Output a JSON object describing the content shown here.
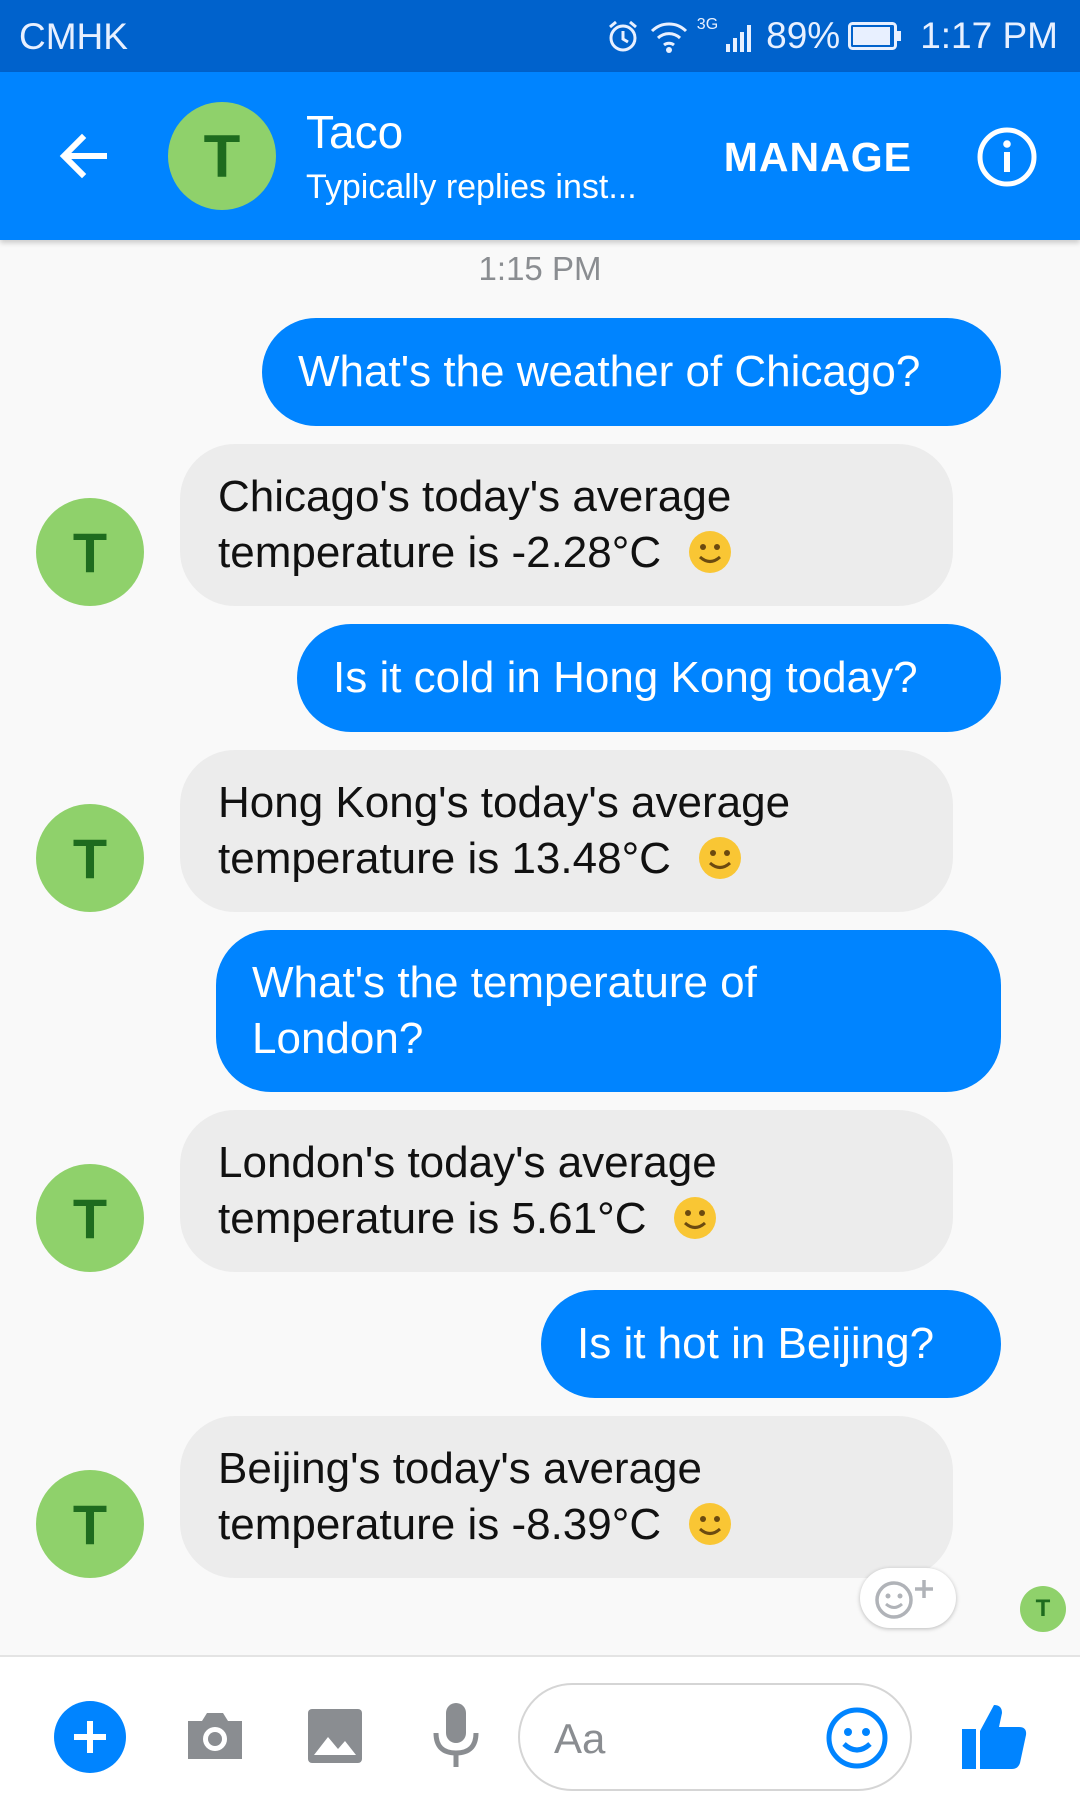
{
  "status_bar": {
    "carrier": "CMHK",
    "network": "3G",
    "battery": "89%",
    "time": "1:17 PM",
    "icons": [
      "alarm-icon",
      "wifi-icon",
      "signal-icon",
      "battery-icon"
    ]
  },
  "header": {
    "contact_initial": "T",
    "contact_name": "Taco",
    "contact_status": "Typically replies inst...",
    "manage_label": "MANAGE",
    "icons": [
      "back-arrow-icon",
      "info-icon"
    ]
  },
  "conversation": {
    "timestamp": "1:15 PM",
    "bot_initial": "T",
    "messages": [
      {
        "from": "user",
        "lines": [
          "What's the weather of Chicago?"
        ]
      },
      {
        "from": "bot",
        "lines": [
          "Chicago's today's average",
          "temperature is -2.28°C"
        ],
        "emoji": "slightly-smiling-face"
      },
      {
        "from": "user",
        "lines": [
          "Is it cold in Hong Kong today?"
        ]
      },
      {
        "from": "bot",
        "lines": [
          "Hong Kong's today's average",
          "temperature is 13.48°C"
        ],
        "emoji": "slightly-smiling-face"
      },
      {
        "from": "user",
        "lines": [
          "What's the temperature of",
          "London?"
        ]
      },
      {
        "from": "bot",
        "lines": [
          "London's today's average",
          "temperature is 5.61°C"
        ],
        "emoji": "slightly-smiling-face"
      },
      {
        "from": "user",
        "lines": [
          "Is it hot in Beijing?"
        ]
      },
      {
        "from": "bot",
        "lines": [
          "Beijing's today's average",
          "temperature is -8.39°C"
        ],
        "emoji": "slightly-smiling-face"
      }
    ],
    "seen_initial": "T"
  },
  "composer": {
    "placeholder": "Aa",
    "icons": [
      "plus-icon",
      "camera-icon",
      "image-icon",
      "microphone-icon",
      "emoji-icon",
      "thumbs-up-icon"
    ]
  },
  "colors": {
    "status_bar": "#0062cc",
    "app_bar": "#0084ff",
    "outgoing_bubble": "#0084ff",
    "incoming_bubble": "#ececec",
    "avatar": "#8fd16b",
    "avatar_letter": "#1e6b1e"
  }
}
